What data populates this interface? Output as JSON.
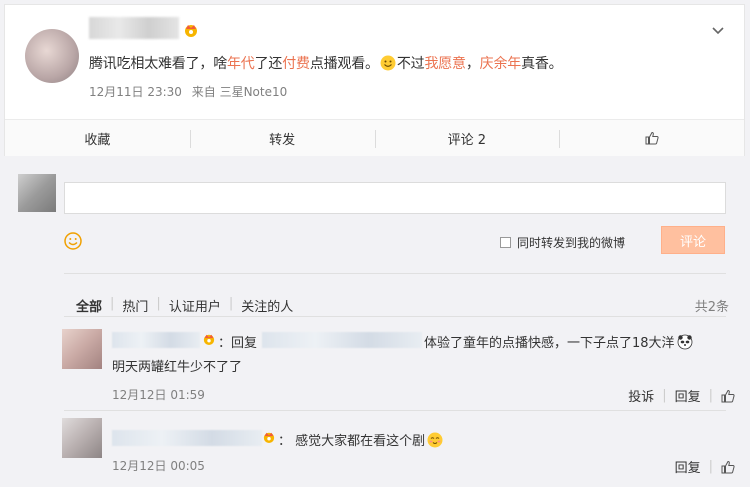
{
  "post": {
    "text_parts": [
      {
        "t": "腾讯吃相太难看了，啥",
        "hl": false
      },
      {
        "t": "年代",
        "hl": true
      },
      {
        "t": "了还",
        "hl": false
      },
      {
        "t": "付费",
        "hl": true
      },
      {
        "t": "点播观看。",
        "hl": false
      }
    ],
    "text_after_emoji": [
      {
        "t": "不过",
        "hl": false
      },
      {
        "t": "我愿意",
        "hl": true
      },
      {
        "t": "，",
        "hl": false
      },
      {
        "t": "庆余年",
        "hl": true
      },
      {
        "t": "真香。",
        "hl": false
      }
    ],
    "time": "12月11日 23:30",
    "source": "来自 三星Note10"
  },
  "actions": {
    "favorite": "收藏",
    "repost": "转发",
    "comment": "评论 2"
  },
  "composer": {
    "forward_label": "同时转发到我的微博",
    "submit": "评论"
  },
  "filters": {
    "all": "全部",
    "hot": "热门",
    "verified": "认证用户",
    "following": "关注的人",
    "total": "共2条"
  },
  "comments": [
    {
      "reply_prefix": "：回复",
      "text1": "体验了童年的点播快感，一下子点了18大洋",
      "text2": "明天两罐红牛少不了了",
      "time": "12月12日 01:59",
      "report": "投诉",
      "reply": "回复"
    },
    {
      "text1": "：  感觉大家都在看这个剧",
      "time": "12月12日 00:05",
      "reply": "回复"
    }
  ],
  "colors": {
    "accent": "#eb7350",
    "submit_bg": "#ffc09f"
  }
}
